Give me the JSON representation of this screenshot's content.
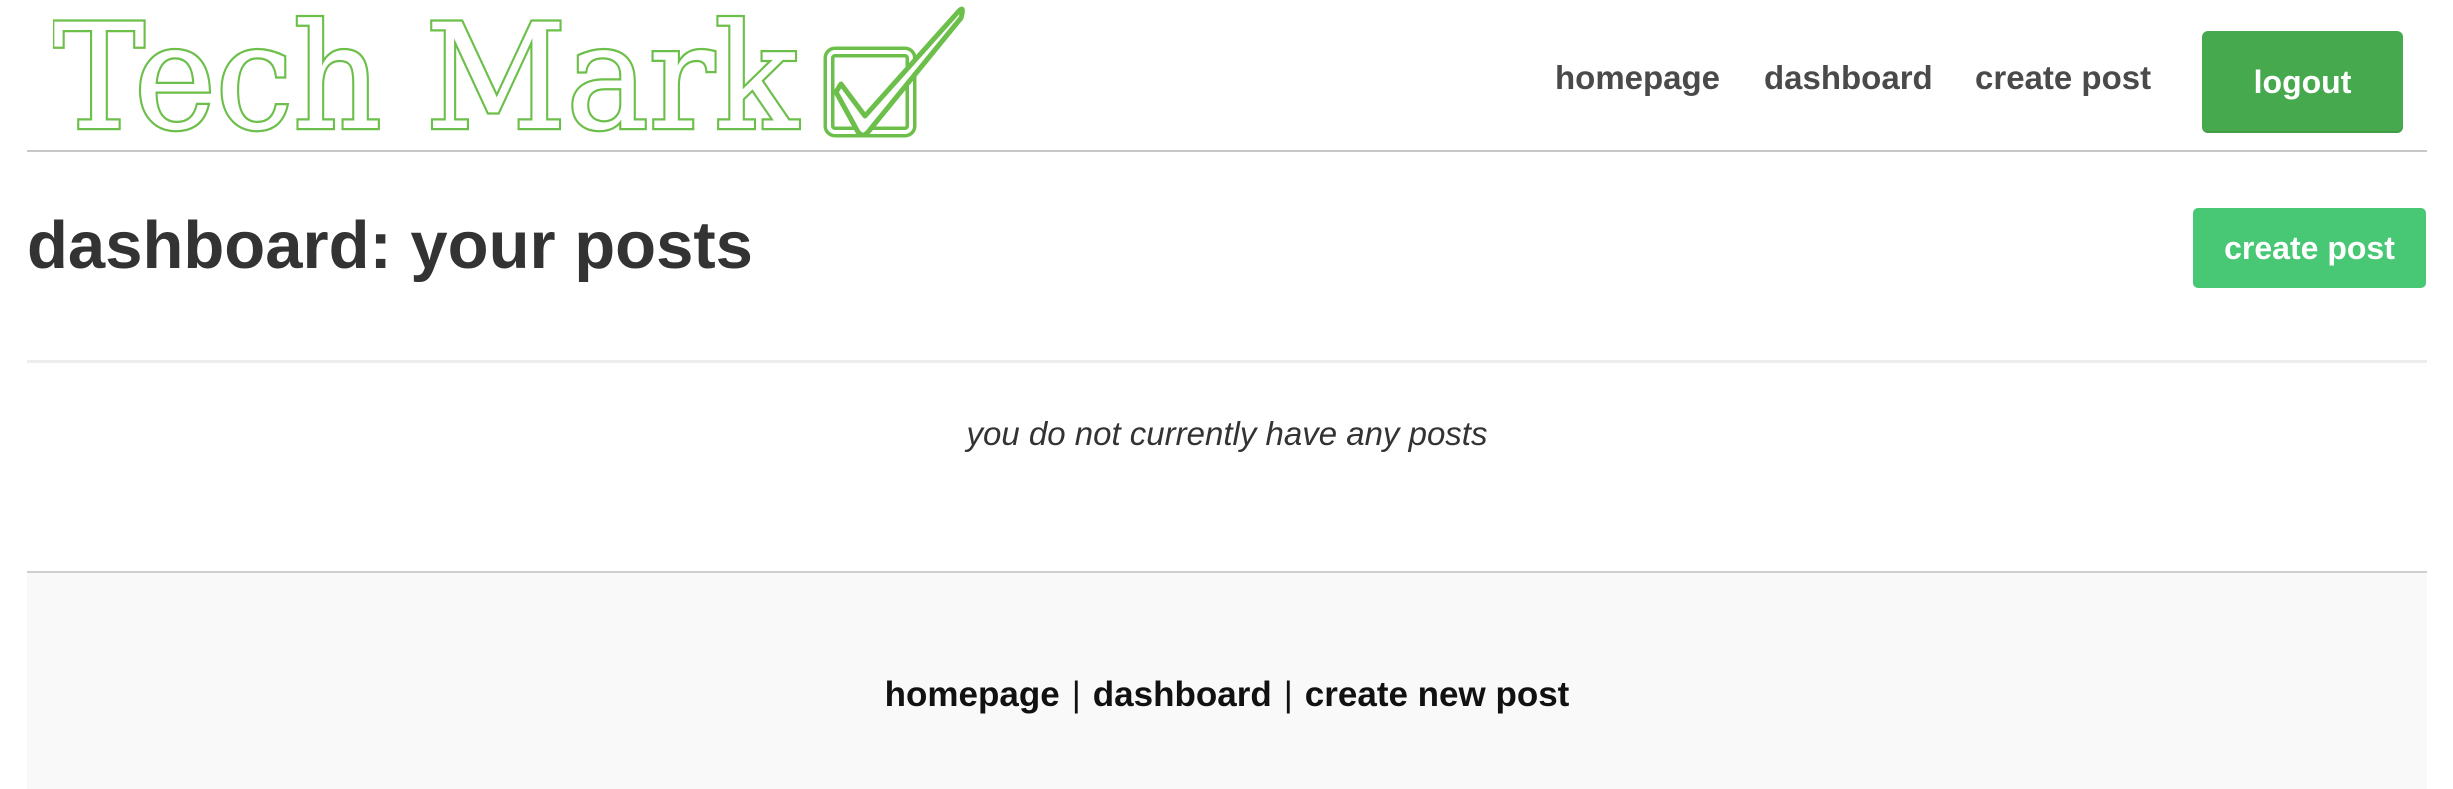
{
  "header": {
    "logo_text": "Tech Mark",
    "logo_color": "#6cbf4a",
    "nav": {
      "homepage": "homepage",
      "dashboard": "dashboard",
      "create_post": "create post"
    },
    "logout_label": "logout",
    "logout_color": "#47a94e"
  },
  "main": {
    "title": "dashboard: your posts",
    "create_button_label": "create post",
    "create_button_color": "#48c774",
    "empty_message": "you do not currently have any posts"
  },
  "footer": {
    "links": {
      "homepage": "homepage",
      "dashboard": "dashboard",
      "create_new_post": "create new post"
    },
    "separator": "|"
  },
  "icons": {
    "logo_checkmark": "checkbox-check-icon"
  }
}
